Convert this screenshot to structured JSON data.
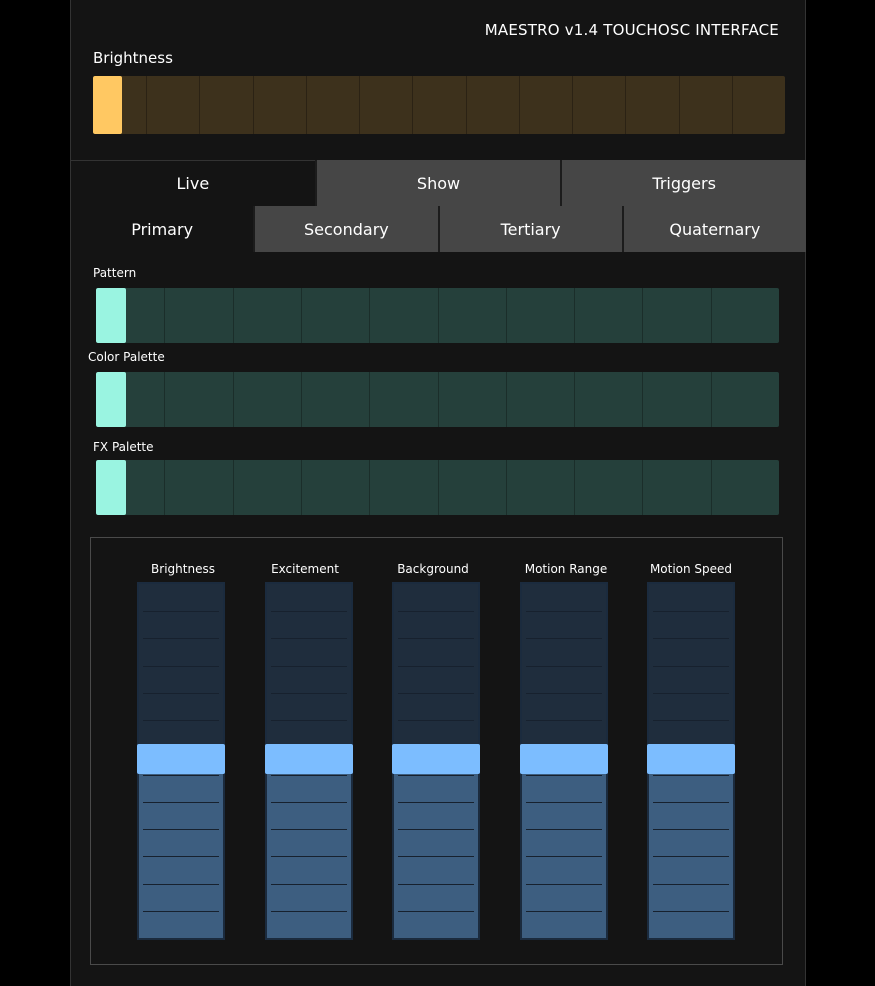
{
  "app_title": "MAESTRO v1.4 TOUCHOSC INTERFACE",
  "brightness": {
    "label": "Brightness",
    "value": 0.0,
    "color": "#ffc862",
    "segments": 13
  },
  "main_tabs": [
    {
      "label": "Live",
      "active": true
    },
    {
      "label": "Show",
      "active": false
    },
    {
      "label": "Triggers",
      "active": false
    }
  ],
  "section_tabs": [
    {
      "label": "Primary",
      "active": true
    },
    {
      "label": "Secondary",
      "active": false
    },
    {
      "label": "Tertiary",
      "active": false
    },
    {
      "label": "Quaternary",
      "active": false
    }
  ],
  "selectors": [
    {
      "label": "Pattern",
      "value": 0,
      "segments": 10,
      "color": "#9af4e1"
    },
    {
      "label": "Color Palette",
      "value": 0,
      "segments": 10,
      "color": "#9af4e1"
    },
    {
      "label": "FX Palette",
      "value": 0,
      "segments": 10,
      "color": "#9af4e1"
    }
  ],
  "faders": [
    {
      "label": "Brightness",
      "value": 0.5
    },
    {
      "label": "Excitement",
      "value": 0.5
    },
    {
      "label": "Background",
      "value": 0.5
    },
    {
      "label": "Motion Range",
      "value": 0.5
    },
    {
      "label": "Motion Speed",
      "value": 0.5
    }
  ],
  "colors": {
    "fader_thumb": "#7cbdff",
    "fader_fill": "#3d5e80",
    "panel_bg": "#141414"
  }
}
